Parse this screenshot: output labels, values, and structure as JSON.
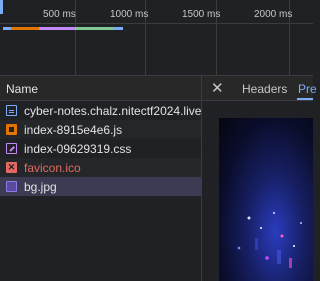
{
  "timeline": {
    "ticks": [
      "500 ms",
      "1000 ms",
      "1500 ms",
      "2000 ms"
    ],
    "bar_colors": [
      "#e37400",
      "#c58af9",
      "#81c995",
      "#7cacf8"
    ]
  },
  "list": {
    "header": "Name",
    "rows": [
      {
        "name": "cyber-notes.chalz.nitectf2024.live",
        "type": "document",
        "color": "#e3e3e3"
      },
      {
        "name": "index-8915e4e6.js",
        "type": "script",
        "color": "#e3e3e3"
      },
      {
        "name": "index-09629319.css",
        "type": "stylesheet",
        "color": "#e3e3e3"
      },
      {
        "name": "favicon.ico",
        "type": "error",
        "color": "#e46962"
      },
      {
        "name": "bg.jpg",
        "type": "image",
        "color": "#e3e3e3",
        "selected": true
      }
    ]
  },
  "details": {
    "close_glyph": "✕",
    "tabs": [
      "Headers",
      "Pre"
    ],
    "active_tab": "Pre"
  },
  "icons": {
    "error_glyph": "✕"
  }
}
